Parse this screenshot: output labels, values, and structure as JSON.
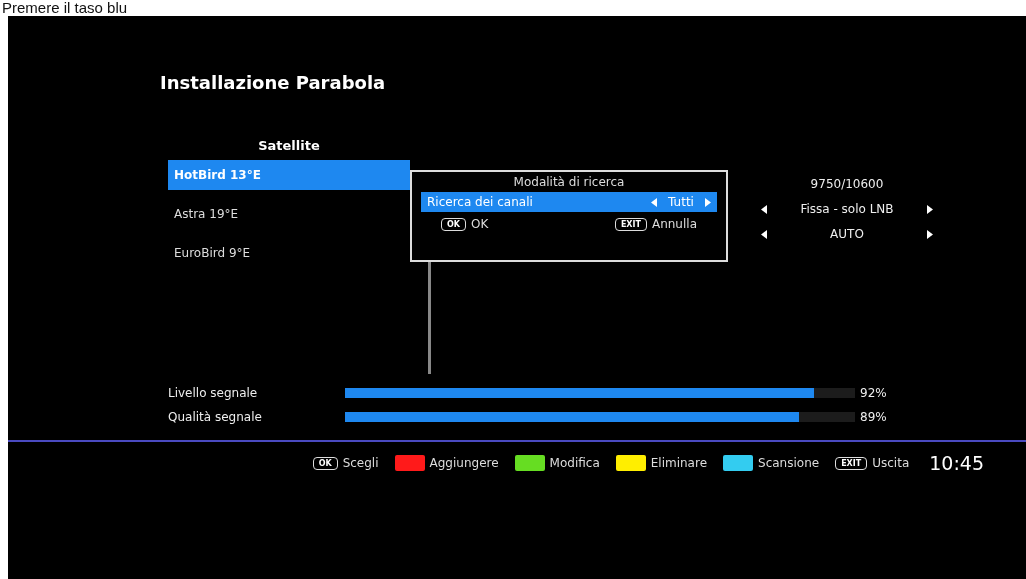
{
  "caption": "Premere il taso blu",
  "screen": {
    "title": "Installazione Parabola",
    "satellite_list": {
      "header": "Satellite",
      "items": [
        {
          "label": "HotBird 13°E",
          "selected": true
        },
        {
          "label": "Astra 19°E",
          "selected": false
        },
        {
          "label": "EuroBird 9°E",
          "selected": false
        }
      ]
    },
    "settings": [
      {
        "kind": "text",
        "value": "9750/10600"
      },
      {
        "kind": "choice",
        "value": "Fissa - solo LNB"
      },
      {
        "kind": "choice",
        "value": "AUTO"
      }
    ],
    "dialog": {
      "title": "Modalità di ricerca",
      "rows": [
        {
          "label": "Ricerca dei canali",
          "value": "Tutti",
          "selected": true
        }
      ],
      "buttons": [
        {
          "key": "OK",
          "label": "OK"
        },
        {
          "key": "EXIT",
          "label": "Annulla"
        }
      ]
    },
    "meters": [
      {
        "label": "Livello segnale",
        "level": 0.92,
        "reading": "92%"
      },
      {
        "label": "Qualità segnale",
        "level": 0.89,
        "reading": "89%"
      }
    ],
    "footer": {
      "hints": [
        {
          "kind": "key",
          "key": "OK",
          "label": "Scegli"
        },
        {
          "kind": "color",
          "color": "#ff1a1a",
          "label": "Aggiungere"
        },
        {
          "kind": "color",
          "color": "#66dd22",
          "label": "Modifica"
        },
        {
          "kind": "color",
          "color": "#ffee00",
          "label": "Eliminare"
        },
        {
          "kind": "color",
          "color": "#33ccf0",
          "label": "Scansione"
        },
        {
          "kind": "key",
          "key": "EXIT",
          "label": "Uscita"
        }
      ],
      "clock": "10:45"
    }
  }
}
